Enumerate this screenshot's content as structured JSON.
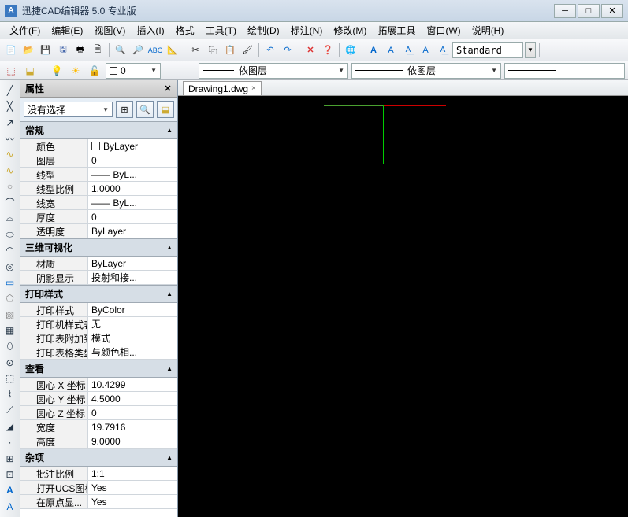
{
  "title": "迅捷CAD编辑器 5.0 专业版",
  "menu": [
    "文件(F)",
    "编辑(E)",
    "视图(V)",
    "插入(I)",
    "格式",
    "工具(T)",
    "绘制(D)",
    "标注(N)",
    "修改(M)",
    "拓展工具",
    "窗口(W)",
    "说明(H)"
  ],
  "toolbar_style": "Standard",
  "layer0": "0",
  "layer_mid": "依图层",
  "layer_right": "依图层",
  "tab": {
    "label": "Drawing1.dwg"
  },
  "props": {
    "title": "属性",
    "selection": "没有选择",
    "groups": [
      {
        "name": "常规",
        "rows": [
          {
            "k": "颜色",
            "v": "ByLayer",
            "swatch": true
          },
          {
            "k": "图层",
            "v": "0"
          },
          {
            "k": "线型",
            "v": "—— ByL..."
          },
          {
            "k": "线型比例",
            "v": "1.0000"
          },
          {
            "k": "线宽",
            "v": "—— ByL..."
          },
          {
            "k": "厚度",
            "v": "0"
          },
          {
            "k": "透明度",
            "v": "ByLayer"
          }
        ]
      },
      {
        "name": "三维可视化",
        "rows": [
          {
            "k": "材质",
            "v": "ByLayer"
          },
          {
            "k": "阴影显示",
            "v": "投射和接..."
          }
        ]
      },
      {
        "name": "打印样式",
        "rows": [
          {
            "k": "打印样式",
            "v": "ByColor"
          },
          {
            "k": "打印机样式表",
            "v": "无"
          },
          {
            "k": "打印表附加到",
            "v": "模式"
          },
          {
            "k": "打印表格类型",
            "v": "与颜色相..."
          }
        ]
      },
      {
        "name": "查看",
        "rows": [
          {
            "k": "圆心 X 坐标",
            "v": "10.4299"
          },
          {
            "k": "圆心 Y 坐标",
            "v": "4.5000"
          },
          {
            "k": "圆心 Z 坐标",
            "v": "0"
          },
          {
            "k": "宽度",
            "v": "19.7916"
          },
          {
            "k": "高度",
            "v": "9.0000"
          }
        ]
      },
      {
        "name": "杂项",
        "rows": [
          {
            "k": "批注比例",
            "v": "1:1"
          },
          {
            "k": "打开UCS图标",
            "v": "Yes"
          },
          {
            "k": "在原点显...",
            "v": "Yes"
          }
        ]
      }
    ]
  }
}
